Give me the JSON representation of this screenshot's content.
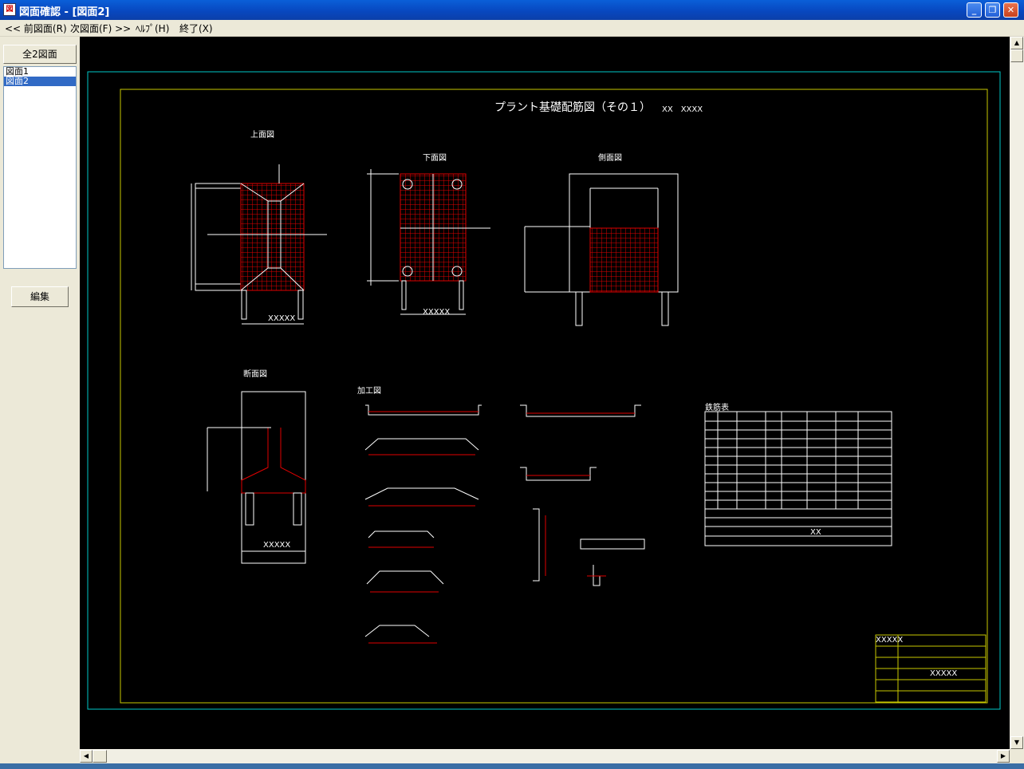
{
  "window": {
    "title": "図面確認 - [図面2]",
    "app_icon": "cad-app-icon",
    "controls": [
      "minimize",
      "restore",
      "close"
    ]
  },
  "menu": {
    "prev": "<< 前図面(R)",
    "next": "次図面(F) >>",
    "help": "ﾍﾙﾌﾟ(H)",
    "exit": "終了(X)"
  },
  "sidebar": {
    "all_button": "全2図面",
    "items": [
      "図面1",
      "図面2"
    ],
    "selected": "図面2",
    "edit_button": "編集"
  },
  "drawing": {
    "title": "プラント基礎配筋図（その１）",
    "title_suffix": "XX　XXXX",
    "views": {
      "top": "上面図",
      "bottom": "下面図",
      "side": "側面図",
      "section": "断面図",
      "processing": "加工図",
      "rebar_table": "鉄筋表"
    },
    "placeholder_short": "XX",
    "placeholder_long": "XXXXX",
    "colors": {
      "frame_outer": "#00c8c8",
      "frame_inner": "#c8c800",
      "line": "#ffffff",
      "rebar": "#e00000",
      "background": "#000000"
    }
  }
}
